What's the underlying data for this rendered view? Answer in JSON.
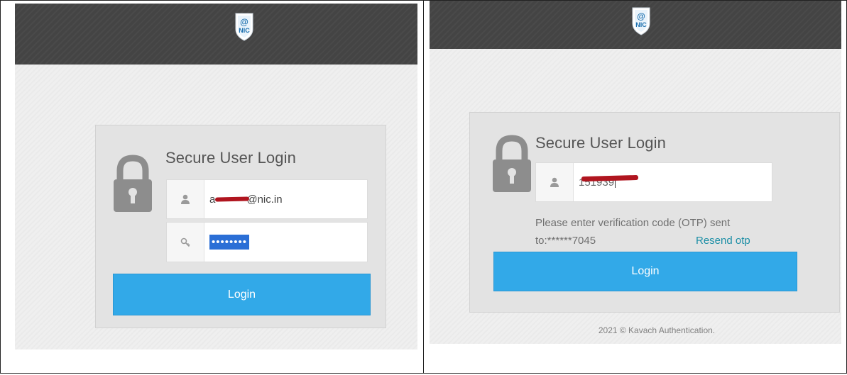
{
  "colors": {
    "topbar": "#444444",
    "panel": "#e3e3e3",
    "button": "#32a9e8",
    "resend_link": "#1d8fa6",
    "redaction": "#b0151f",
    "selection": "#2b6fd6"
  },
  "logo": {
    "text_top": "@",
    "text_bottom": "NIC"
  },
  "left_screen": {
    "heading": "Secure User Login",
    "username": {
      "icon": "user-icon",
      "value_suffix": "@nic.in"
    },
    "password": {
      "icon": "key-icon",
      "value": "••••••••"
    },
    "login_button": "Login"
  },
  "right_screen": {
    "heading": "Secure User Login",
    "otp": {
      "icon": "user-icon",
      "value": "151939"
    },
    "otp_message": "Please enter verification code (OTP) sent",
    "otp_destination": "to:******7045",
    "resend_link": "Resend otp",
    "login_button": "Login",
    "footer": "2021 © Kavach Authentication."
  }
}
